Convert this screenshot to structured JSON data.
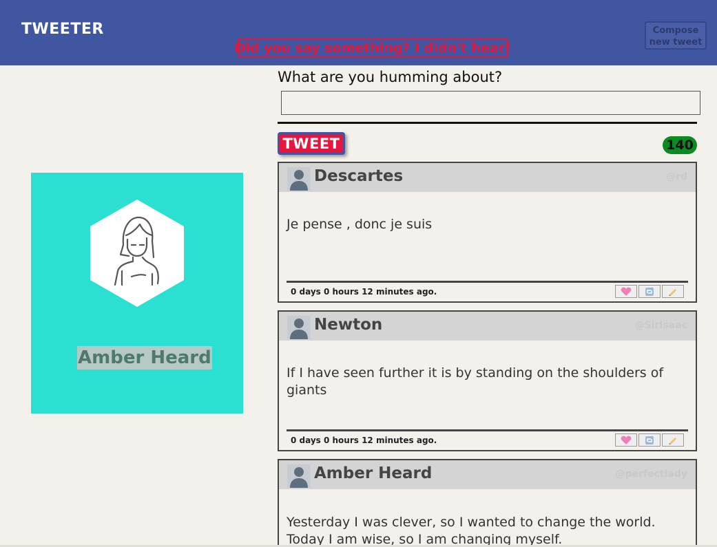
{
  "nav": {
    "logo": "TWEETER",
    "error_message": "Did you say something? I didn't hear!",
    "compose_label": "Compose new tweet"
  },
  "profile": {
    "name": "Amber Heard",
    "card_color": "#2be0d2"
  },
  "composer": {
    "prompt": "What are you humming about?",
    "input_value": "",
    "tweet_button": "TWEET",
    "char_counter": "140"
  },
  "tweets": [
    {
      "author": "Descartes",
      "handle": "@rd",
      "text": "Je pense , donc je suis",
      "time": "0 days 0 hours 12 minutes ago.",
      "actions": [
        "heart-icon",
        "retweet-icon",
        "flag-icon"
      ]
    },
    {
      "author": "Newton",
      "handle": "@SirIsaac",
      "text": "If I have seen further it is by standing on the shoulders of giants",
      "time": "0 days 0 hours 12 minutes ago.",
      "actions": [
        "heart-icon",
        "retweet-icon",
        "flag-icon"
      ]
    },
    {
      "author": "Amber Heard",
      "handle": "@perfectlady",
      "text": "Yesterday I was clever, so I wanted to change the world. Today I am wise, so I am changing myself.",
      "time": "",
      "actions": []
    }
  ],
  "colors": {
    "nav": "#4056a1",
    "accent_red": "#e5173f",
    "counter_green": "#0a8c22",
    "background": "#f4f1ec"
  }
}
